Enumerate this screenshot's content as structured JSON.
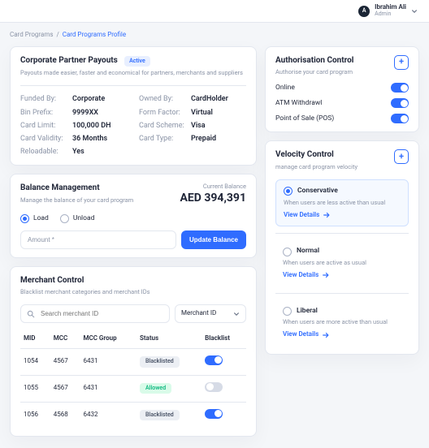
{
  "user": {
    "initial": "A",
    "name": "Ibrahim Ali",
    "role": "Admin"
  },
  "breadcrumbs": {
    "root": "Card Programs",
    "current": "Card Programs Profile"
  },
  "payouts": {
    "title": "Corporate Partner Payouts",
    "status": "Active",
    "subtitle": "Payouts made easier, faster and economical for partners, merchants and suppliers",
    "fields": {
      "funded_by": {
        "label": "Funded By:",
        "value": "Corporate"
      },
      "owned_by": {
        "label": "Owned By:",
        "value": "CardHolder"
      },
      "bin_prefix": {
        "label": "Bin Prefix:",
        "value": "9999XX"
      },
      "form_factor": {
        "label": "Form Factor:",
        "value": "Virtual"
      },
      "card_limit": {
        "label": "Card Limit:",
        "value": "100,000 DH"
      },
      "card_scheme": {
        "label": "Card Scheme:",
        "value": "Visa"
      },
      "card_validity": {
        "label": "Card Validity:",
        "value": "36 Months"
      },
      "card_type": {
        "label": "Card Type:",
        "value": "Prepaid"
      },
      "reloadable": {
        "label": "Reloadable:",
        "value": "Yes"
      }
    }
  },
  "balance": {
    "title": "Balance Management",
    "subtitle": "Manage the balance of your card program",
    "current_label": "Current Balance",
    "current_value": "AED 394,391",
    "options": {
      "load": "Load",
      "unload": "Unload"
    },
    "amount_placeholder": "Amount *",
    "button": "Update Balance"
  },
  "merchant": {
    "title": "Merchant Control",
    "subtitle": "Blacklist merchant categories and merchant IDs",
    "search_placeholder": "Search merchant ID",
    "filter": "Merchant ID",
    "columns": {
      "mid": "MID",
      "mcc": "MCC",
      "mcc_group": "MCC Group",
      "status": "Status",
      "blacklist": "Blacklist"
    },
    "status_labels": {
      "blacklisted": "Blacklisted",
      "allowed": "Allowed"
    },
    "rows": [
      {
        "mid": "1054",
        "mcc": "4567",
        "mcc_group": "6431",
        "status": "blacklisted",
        "blacklist_on": true
      },
      {
        "mid": "1055",
        "mcc": "4567",
        "mcc_group": "6431",
        "status": "allowed",
        "blacklist_on": false
      },
      {
        "mid": "1056",
        "mcc": "4568",
        "mcc_group": "6432",
        "status": "blacklisted",
        "blacklist_on": true
      }
    ]
  },
  "auth": {
    "title": "Authorisation Control",
    "subtitle": "Authorise your card program",
    "items": [
      {
        "label": "Online",
        "on": true
      },
      {
        "label": "ATM Withdrawl",
        "on": true
      },
      {
        "label": "Point of Sale (POS)",
        "on": true
      }
    ]
  },
  "velocity": {
    "title": "Velocity Control",
    "subtitle": "manage card program velocity",
    "view_details": "View Details",
    "options": [
      {
        "name": "Conservative",
        "desc": "When users are less active than usual",
        "selected": true
      },
      {
        "name": "Normal",
        "desc": "When users are active as usual",
        "selected": false
      },
      {
        "name": "Liberal",
        "desc": "When users are more active than usual",
        "selected": false
      }
    ]
  }
}
